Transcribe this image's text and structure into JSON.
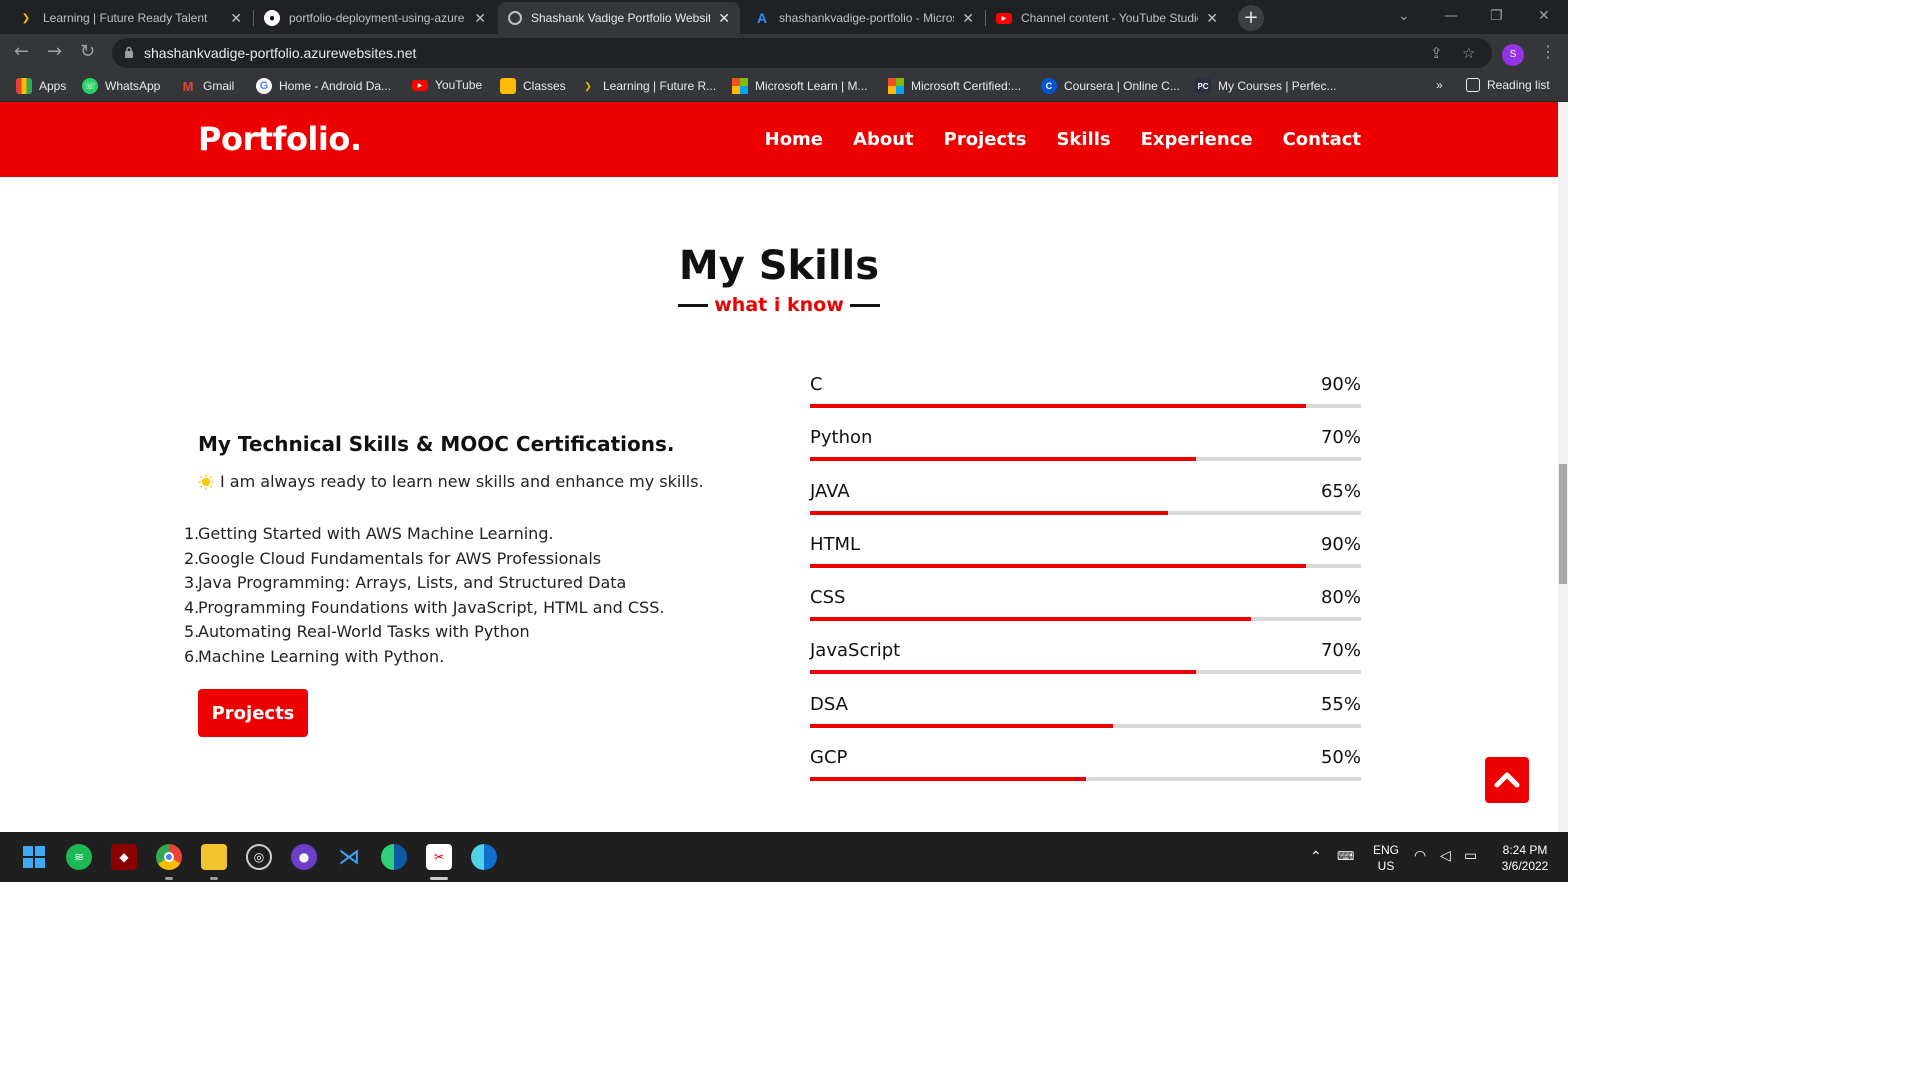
{
  "browser": {
    "tabs": [
      {
        "title": "Learning | Future Ready Talent",
        "favicon": "chevron-yellow-icon",
        "active": false
      },
      {
        "title": "portfolio-deployment-using-azure",
        "favicon": "github-icon",
        "active": false
      },
      {
        "title": "Shashank Vadige Portfolio Website",
        "favicon": "globe-icon",
        "active": true
      },
      {
        "title": "shashankvadige-portfolio - Microsoft Azure",
        "favicon": "azure-icon",
        "active": false
      },
      {
        "title": "Channel content - YouTube Studio",
        "favicon": "youtube-icon",
        "active": false
      }
    ],
    "new_tab": "+",
    "url": "shashankvadige-portfolio.azurewebsites.net",
    "profile_initial": "S",
    "bookmarks": [
      {
        "label": "Apps",
        "icon": "apps-grid-icon"
      },
      {
        "label": "WhatsApp",
        "icon": "whatsapp-icon"
      },
      {
        "label": "Gmail",
        "icon": "gmail-icon"
      },
      {
        "label": "Home - Android Da...",
        "icon": "google-icon"
      },
      {
        "label": "YouTube",
        "icon": "youtube-icon"
      },
      {
        "label": "Classes",
        "icon": "classroom-icon"
      },
      {
        "label": "Learning | Future R...",
        "icon": "chevron-yellow-icon"
      },
      {
        "label": "Microsoft Learn | M...",
        "icon": "microsoft-icon"
      },
      {
        "label": "Microsoft Certified:...",
        "icon": "microsoft-icon"
      },
      {
        "label": "Coursera | Online C...",
        "icon": "coursera-icon"
      },
      {
        "label": "My Courses | Perfec...",
        "icon": "pc-icon"
      }
    ],
    "bookmarks_overflow": "»",
    "reading_list": "Reading list"
  },
  "site": {
    "brand": "Portfolio.",
    "nav": [
      "Home",
      "About",
      "Projects",
      "Skills",
      "Experience",
      "Contact"
    ],
    "section_title": "My Skills",
    "section_subtitle": "what i know",
    "tech_heading": "My Technical Skills & MOOC Certifications.",
    "intro": "I am always ready to learn new skills and enhance my skills.",
    "certifications": [
      "Getting Started with AWS Machine Learning.",
      "Google Cloud Fundamentals for AWS Professionals",
      "Java Programming: Arrays, Lists, and Structured Data",
      "Programming Foundations with JavaScript, HTML and CSS.",
      "Automating Real-World Tasks with Python",
      "Machine Learning with Python."
    ],
    "projects_button": "Projects",
    "skills": [
      {
        "name": "C",
        "percent": 90,
        "label": "90%"
      },
      {
        "name": "Python",
        "percent": 70,
        "label": "70%"
      },
      {
        "name": "JAVA",
        "percent": 65,
        "label": "65%"
      },
      {
        "name": "HTML",
        "percent": 90,
        "label": "90%"
      },
      {
        "name": "CSS",
        "percent": 80,
        "label": "80%"
      },
      {
        "name": "JavaScript",
        "percent": 70,
        "label": "70%"
      },
      {
        "name": "DSA",
        "percent": 55,
        "label": "55%"
      },
      {
        "name": "GCP",
        "percent": 50,
        "label": "50%"
      }
    ],
    "accent_color": "#ee0000"
  },
  "taskbar": {
    "apps": [
      "windows-start-icon",
      "spotify-icon",
      "app-icon",
      "chrome-icon",
      "file-explorer-icon",
      "obs-icon",
      "github-desktop-icon",
      "vscode-icon",
      "edge-icon",
      "snipping-tool-icon",
      "edge-dev-icon"
    ],
    "lang_top": "ENG",
    "lang_bottom": "US",
    "time": "8:24 PM",
    "date": "3/6/2022"
  }
}
